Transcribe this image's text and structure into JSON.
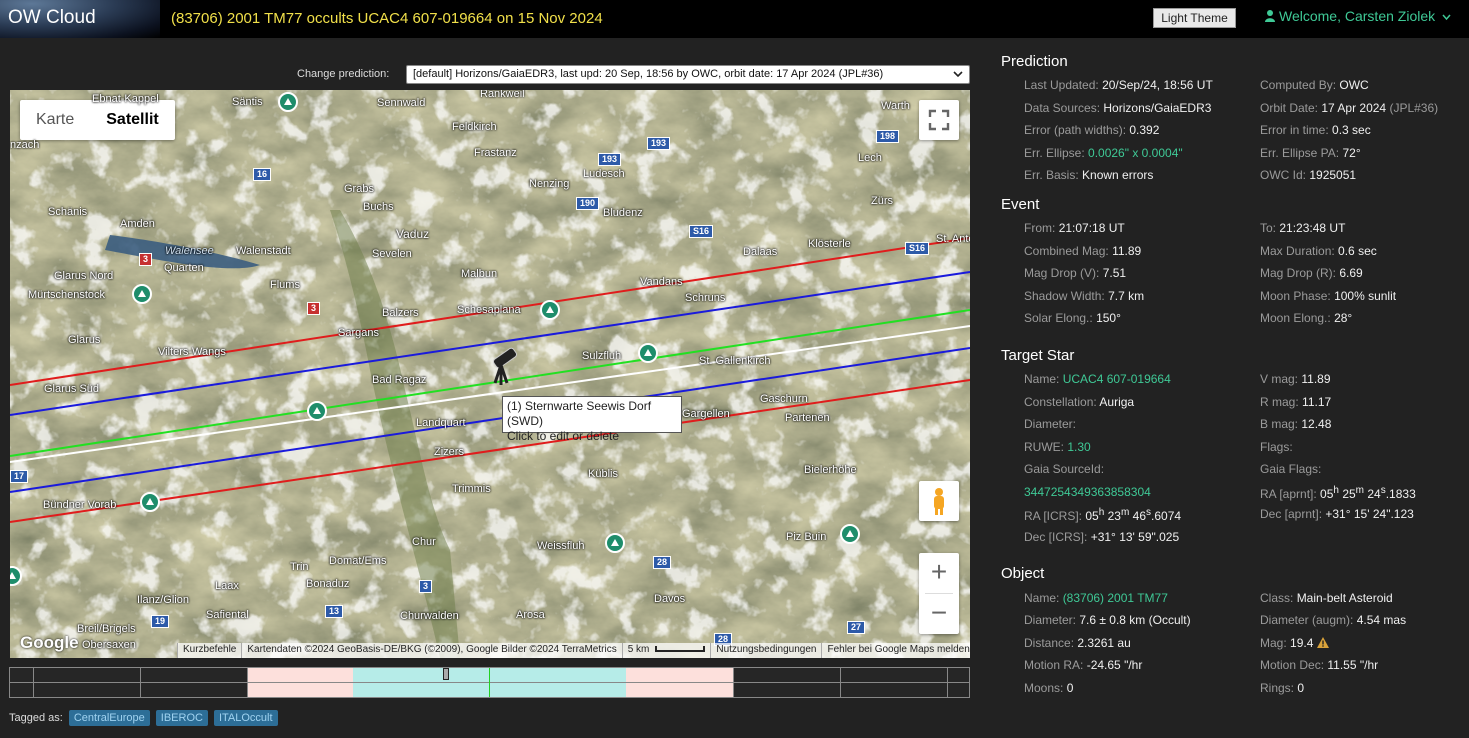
{
  "app": {
    "logo": "OW Cloud",
    "title": "(83706) 2001 TM77 occults UCAC4 607-019664 on 15 Nov 2024",
    "theme_button": "Light Theme",
    "welcome": "Welcome, Carsten Ziolek"
  },
  "prediction_select": {
    "label": "Change prediction:",
    "value": "[default] Horizons/GaiaEDR3, last upd: 20 Sep, 18:56 by OWC, orbit date: 17 Apr 2024 (JPL#36)"
  },
  "map": {
    "maptype": [
      "Karte",
      "Satellit"
    ],
    "tooltip": [
      "(1) Sternwarte Seewis Dorf (SWD)",
      "Click to edit or delete"
    ],
    "places": [
      "Säntis",
      "Sennwald",
      "Rankweil",
      "Warth",
      "Ebnat-Kappel",
      "Feldkirch",
      "Frastanz",
      "Lech",
      "nzach",
      "Nenzing",
      "Ludesch",
      "Grabs",
      "Buchs",
      "Bludenz",
      "Zürs",
      "Schänis",
      "Amden",
      "Walensee",
      "Vaduz",
      "Walenstadt",
      "Quarten",
      "Sevelen",
      "Dalaas",
      "Klösterle",
      "St. Anton am Arlberg",
      "Glarus Nord",
      "Malbun",
      "Vandans",
      "Mürtschenstock",
      "Flums",
      "Schruns",
      "Balzers",
      "Schesaplana",
      "Sargans",
      "Vilters-Wangs",
      "Sulzfluh",
      "St. Gallenkirch",
      "Glarus",
      "Bad Ragaz",
      "Glarus Süd",
      "Gaschurn",
      "Landquart",
      "Partenen",
      "Gargellen",
      "Zizers",
      "Trimmis",
      "Küblis",
      "Bielerhöhe",
      "Bündner Vorab",
      "Chur",
      "Weissfluh",
      "Piz Buin",
      "Domat/Ems",
      "Trin",
      "Bonaduz",
      "Laax",
      "Davos",
      "Ilanz/Glion",
      "Churwalden",
      "Safiental",
      "Arosa",
      "Breil/Brigels",
      "Obersaxen"
    ],
    "roads": [
      "16",
      "193",
      "193",
      "198",
      "190",
      "S16",
      "3",
      "3",
      "S16",
      "3",
      "28",
      "13",
      "19",
      "28",
      "27",
      "17"
    ],
    "attribution": [
      "Kurzbefehle",
      "Kartendaten ©2024 GeoBasis-DE/BKG (©2009), Google Bilder ©2024 TerraMetrics",
      "5 km",
      "Nutzungsbedingungen",
      "Fehler bei Google Maps melden"
    ],
    "google": "Google",
    "zoom_in": "+",
    "zoom_out": "−"
  },
  "tags": {
    "label": "Tagged as:",
    "items": [
      "CentralEurope",
      "IBEROC",
      "ITALOccult"
    ]
  },
  "prediction": {
    "title": "Prediction",
    "left": [
      {
        "k": "Last Updated:",
        "v": "20/Sep/24, 18:56 UT"
      },
      {
        "k": "Data Sources:",
        "v": "Horizons/GaiaEDR3"
      },
      {
        "k": "Error (path widths):",
        "v": "0.392"
      },
      {
        "k": "Err. Ellipse:",
        "v": "0.0026\" x 0.0004\""
      },
      {
        "k": "Err. Basis:",
        "v": "Known errors"
      }
    ],
    "right": [
      {
        "k": "Computed By:",
        "v": "OWC"
      },
      {
        "k": "Orbit Date:",
        "v": "17 Apr 2024",
        "extra": "(JPL#36)"
      },
      {
        "k": "Error in time:",
        "v": "0.3 sec"
      },
      {
        "k": "Err. Ellipse PA:",
        "v": "72°"
      },
      {
        "k": "OWC Id:",
        "v": "1925051"
      }
    ]
  },
  "event": {
    "title": "Event",
    "left": [
      {
        "k": "From:",
        "v": "21:07:18 UT"
      },
      {
        "k": "Combined Mag:",
        "v": "11.89"
      },
      {
        "k": "Mag Drop (V):",
        "v": "7.51"
      },
      {
        "k": "Shadow Width:",
        "v": "7.7 km"
      },
      {
        "k": "Solar Elong.:",
        "v": "150°"
      }
    ],
    "right": [
      {
        "k": "To:",
        "v": "21:23:48 UT"
      },
      {
        "k": "Max Duration:",
        "v": "0.6 sec"
      },
      {
        "k": "Mag Drop (R):",
        "v": "6.69"
      },
      {
        "k": "Moon Phase:",
        "v": "100% sunlit"
      },
      {
        "k": "Moon Elong.:",
        "v": "28°"
      }
    ]
  },
  "target_star": {
    "title": "Target Star",
    "name": {
      "k": "Name:",
      "v": "UCAC4 607-019664"
    },
    "constellation": {
      "k": "Constellation:",
      "v": "Auriga"
    },
    "diameter": {
      "k": "Diameter:"
    },
    "ruwe": {
      "k": "RUWE:",
      "v": "1.30"
    },
    "gaia_label": {
      "k": "Gaia SourceId:"
    },
    "gaia_id": "3447254349363858304",
    "ra_icrs": {
      "k": "RA [ICRS]:",
      "h": "05",
      "m": "23",
      "s": "46",
      "frac": ".6074"
    },
    "dec_icrs": {
      "k": "Dec [ICRS]:",
      "d": "+31° 13",
      "s": "59",
      "frac": ".025"
    },
    "vmag": {
      "k": "V mag:",
      "v": "11.89"
    },
    "rmag": {
      "k": "R mag:",
      "v": "11.17"
    },
    "bmag": {
      "k": "B mag:",
      "v": "12.48"
    },
    "flags": {
      "k": "Flags:"
    },
    "gaia_flags": {
      "k": "Gaia Flags:"
    },
    "ra_aprnt": {
      "k": "RA [aprnt]:",
      "h": "05",
      "m": "25",
      "s": "24",
      "frac": ".1833"
    },
    "dec_aprnt": {
      "k": "Dec [aprnt]:",
      "d": "+31° 15",
      "s": "24",
      "frac": ".123"
    }
  },
  "object": {
    "title": "Object",
    "left": [
      {
        "k": "Name:",
        "v": "(83706) 2001 TM77",
        "link": true
      },
      {
        "k": "Diameter:",
        "v": "7.6 ± 0.8 km (Occult)"
      },
      {
        "k": "Distance:",
        "v": "2.3261 au"
      },
      {
        "k": "Motion RA:",
        "v": "-24.65 \"/hr"
      },
      {
        "k": "Moons:",
        "v": "0"
      }
    ],
    "right": [
      {
        "k": "Class:",
        "v": "Main-belt Asteroid"
      },
      {
        "k": "Diameter (augm):",
        "v": "4.54 mas"
      },
      {
        "k": "Mag:",
        "v": "19.4"
      },
      {
        "k": "Motion Dec:",
        "v": "11.55 \"/hr"
      },
      {
        "k": "Rings:",
        "v": "0"
      }
    ]
  },
  "colors": {
    "accent": "#3fc996",
    "title": "#f1e04a",
    "path_red": "#e01c1c",
    "path_blue": "#1a1adc",
    "path_green": "#22e022",
    "path_white": "#ffffff",
    "timeline_pink": "#fde0dc",
    "timeline_cyan": "#b6ece8"
  }
}
